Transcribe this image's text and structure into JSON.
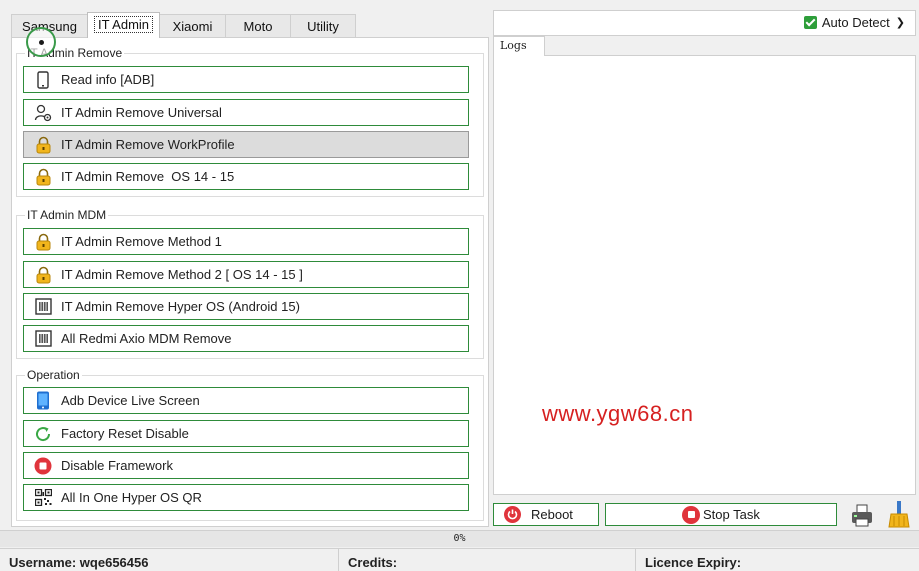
{
  "tabs": [
    {
      "label": "Samsung"
    },
    {
      "label": "IT Admin"
    },
    {
      "label": "Xiaomi"
    },
    {
      "label": "Moto"
    },
    {
      "label": "Utility"
    }
  ],
  "groups": {
    "it_admin_remove": {
      "title": "IT Admin Remove",
      "buttons": [
        {
          "label": "Read info [ADB]",
          "icon": "phone-icon"
        },
        {
          "label": "IT Admin Remove Universal",
          "icon": "user-gear-icon"
        },
        {
          "label": "IT Admin Remove WorkProfile",
          "icon": "lock-icon"
        },
        {
          "label": "IT Admin Remove  OS 14 - 15",
          "icon": "lock-icon"
        }
      ]
    },
    "it_admin_mdm": {
      "title": "IT Admin MDM",
      "buttons": [
        {
          "label": "IT Admin Remove Method 1",
          "icon": "lock-icon"
        },
        {
          "label": "IT Admin Remove Method 2 [ OS 14 - 15 ]",
          "icon": "lock-icon"
        },
        {
          "label": "IT Admin Remove Hyper OS (Android 15)",
          "icon": "chip-icon"
        },
        {
          "label": "All Redmi Axio MDM Remove",
          "icon": "chip-icon"
        }
      ]
    },
    "operation": {
      "title": "Operation",
      "buttons": [
        {
          "label": "Adb Device Live Screen",
          "icon": "mobile-icon"
        },
        {
          "label": "Factory Reset Disable",
          "icon": "refresh-icon"
        },
        {
          "label": "Disable Framework",
          "icon": "stop-icon"
        },
        {
          "label": "All In One Hyper OS QR",
          "icon": "qr-icon"
        }
      ]
    }
  },
  "right": {
    "auto_detect_label": "Auto Detect",
    "auto_detect_checked": true,
    "logs_tab": "Logs",
    "watermark": "www.ygw68.cn",
    "reboot_label": "Reboot",
    "stop_label": "Stop Task"
  },
  "progress": {
    "text": "0%",
    "value": 0
  },
  "status": {
    "username": "Username: wqe656456",
    "credits": "Credits:",
    "licence": "Licence Expiry:"
  },
  "colors": {
    "accent_border": "#2e8b3a",
    "danger": "#e0343c",
    "watermark": "#d62020"
  }
}
